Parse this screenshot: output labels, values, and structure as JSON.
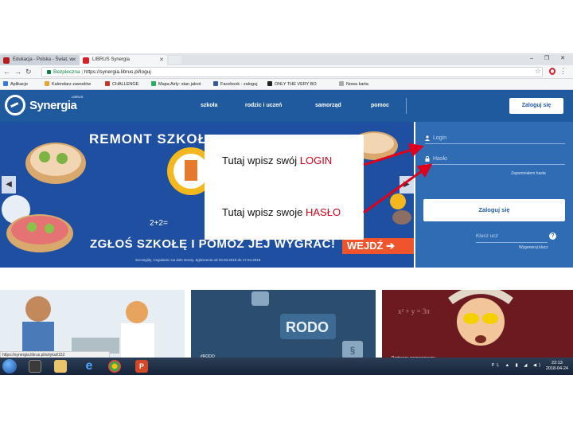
{
  "browser": {
    "tabs": [
      {
        "label": "Edukacja - Polska - Świat, w"
      },
      {
        "label": "LIBRUS Synergia"
      }
    ],
    "address_bar": {
      "security_label": "Bezpieczna",
      "url": "https://synergia.librus.pl/loguj"
    },
    "bookmarks": [
      "Aplikacje",
      "Kalendarz zawodów",
      "CHALLENGE",
      "Mapa Airly: stan jakoś",
      "Facebook - zaloguj",
      "ONLY THE VERY BO",
      "Nowa karta"
    ]
  },
  "site": {
    "logo_text": "Synergia",
    "logo_small": "LIBRUS",
    "nav": [
      "szkoła",
      "rodzic i uczeń",
      "samorząd",
      "pomoc"
    ],
    "header_login": "Zaloguj się"
  },
  "banner": {
    "title": "REMONT SZKOŁ",
    "bottom": "ZGŁOŚ SZKOŁĘ I POMÓŻ JEJ WYGRAĆ!",
    "cta": "WEJDŹ ➔",
    "small_print": "Szczegóły i regulamin na dole strony. Zgłoszenia od 03.03.2018 do 17.04.2018."
  },
  "login_panel": {
    "login_placeholder": "Login",
    "password_placeholder": "Hasło",
    "forgot": "Zapomniałem hasła",
    "submit": "Zaloguj się",
    "key_placeholder": "Klucz ucz",
    "generate": "Wygeneruj klucz"
  },
  "overlay": {
    "line1_prefix": "Tutaj wpisz  swój ",
    "line1_highlight": "LOGIN",
    "line2_prefix": "Tutaj wpisz swoje ",
    "line2_highlight": "HASŁO"
  },
  "tiles": {
    "rodo_title": "RODO",
    "rodo_tag": "#RODO",
    "partner_tag": "Partnerzy sponsorowany"
  },
  "status_url": "https://synergia.librus.pl/artykuł/152",
  "taskbar": {
    "tray": "PL",
    "time": "22:13",
    "date": "2018-04-24"
  },
  "colors": {
    "brand_blue": "#1f5a9e",
    "panel_blue": "#2f6cb4",
    "highlight_red": "#d0021b",
    "cta_orange": "#f0542d"
  }
}
